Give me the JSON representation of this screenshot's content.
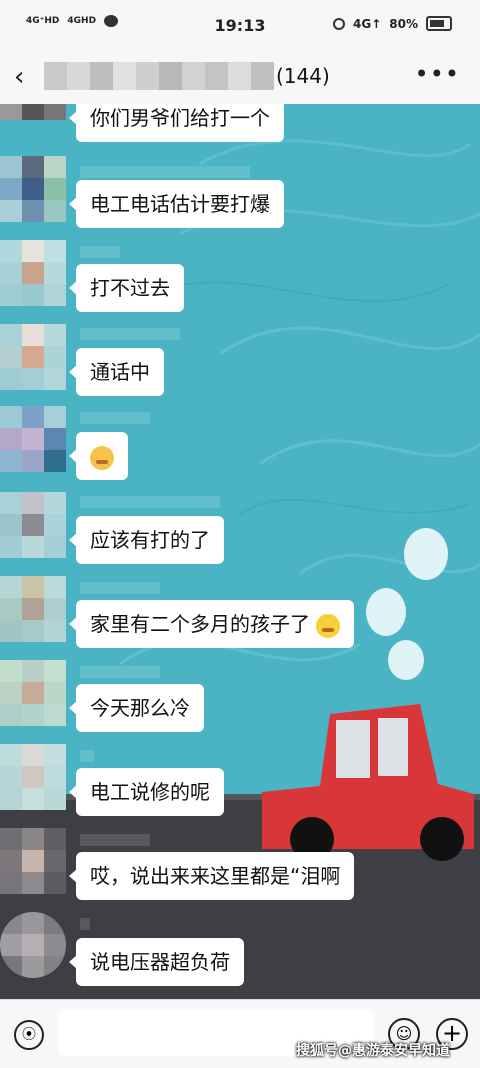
{
  "status_bar": {
    "network_1": "4G⁺HD",
    "network_2": "4GHD",
    "time": "19:13",
    "network_3": "4G↑",
    "battery": "80%"
  },
  "header": {
    "member_count": "(144)"
  },
  "messages": [
    {
      "text": "你们男爷们给打一个"
    },
    {
      "text": "电工电话估计要打爆"
    },
    {
      "text": "打不过去"
    },
    {
      "text": "通话中"
    },
    {
      "text": "",
      "emoji": "grimacing-face"
    },
    {
      "text": "应该有打的了"
    },
    {
      "text": "家里有二个多月的孩子了",
      "emoji": "crying-face"
    },
    {
      "text": "今天那么冷"
    },
    {
      "text": "电工说修的呢"
    },
    {
      "text": "哎，说出来来这里都是“泪啊"
    },
    {
      "text": "说电压器超负荷"
    }
  ],
  "watermark": "搜狐号@惠游泰安早知道",
  "colors": {
    "chat_background": "#4bb4c4",
    "bubble": "#ffffff",
    "car": "#d9363a"
  }
}
